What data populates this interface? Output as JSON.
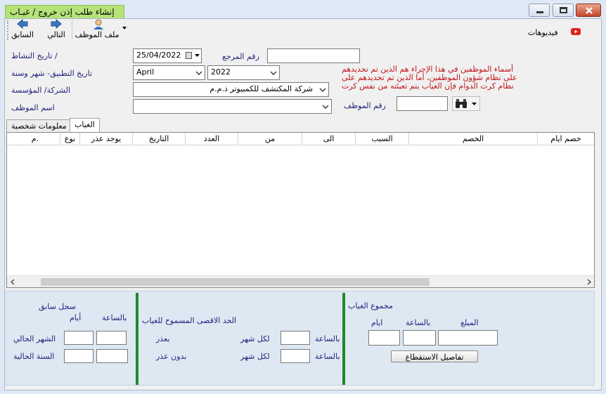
{
  "window": {
    "title": "إنشاء طلب إذن خروج / غيـاب"
  },
  "toolbar": {
    "employee_file": "ملف الموظف",
    "next": "التالي",
    "previous": "السابق"
  },
  "videos": {
    "label": "فيديوهات"
  },
  "form": {
    "activity_date_label": "/ تاريخ النشاط",
    "activity_date_value": "25/04/2022",
    "reference_no_label": "رقم المرجع",
    "reference_no_value": "",
    "apply_date_label": "تاريخ التطبيق- شهر وسنة",
    "month_value": "April",
    "year_value": "2022",
    "company_label": "الشركة/ المؤسسة",
    "company_value": "شركة المكتشف للكمبيوتر ذ.م.م",
    "employee_name_label": "اسم الموظف",
    "employee_name_value": "",
    "employee_no_label": "رقم الموظف",
    "employee_no_value": "",
    "note_line1": "أسماء الموظفين في هذا الإجراء هم الذين تم تحديدهم",
    "note_line2": "على نظام شؤون الموظفين، أما الذين تم تحديدهم على",
    "note_line3": "نظام كرت الدوام فإن الغياب يتم تعبئته من نفس كرت"
  },
  "tabs": {
    "absence": "الغياب",
    "personal_info": "معلومات شخصية"
  },
  "grid": {
    "columns": [
      "خصم ايام",
      "الخصم",
      "السبب",
      "الى",
      "من",
      "العدد",
      "التاريخ",
      "يوجد عذر",
      "نوع",
      "م."
    ]
  },
  "previous_record": {
    "title": "سجل سابق",
    "hours_label": "بالساعة",
    "days_label": "أيام",
    "current_month_label": "الشهر الحالي",
    "current_year_label": "السنة الحالية"
  },
  "max_allowed": {
    "title": "الحد الاقصى المسموح للغياب",
    "with_excuse_label": "بعذر",
    "without_excuse_label": "بدون عذر",
    "per_month_1": "لكل شهر",
    "per_month_2": "لكل شهر",
    "hourly_1": "بالساعة",
    "hourly_2": "بالساعة"
  },
  "absence_total": {
    "title": "مجموع الغياب",
    "days_label": "ايام",
    "hours_label": "بالساعة",
    "amount_label": "المبلغ",
    "deduction_details_button": "تفاصيل الاستقطاع"
  },
  "colors": {
    "title_highlight": "#b6e27a",
    "red_note": "#c0141a",
    "green_divider": "#1e8a2a",
    "youtube_red": "#e02020"
  }
}
